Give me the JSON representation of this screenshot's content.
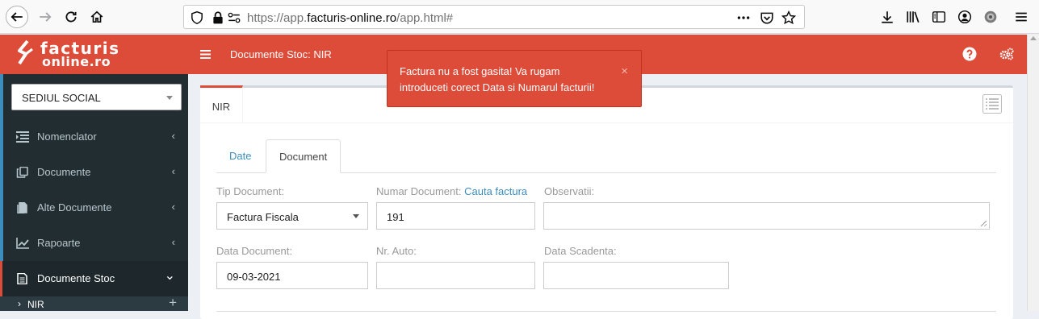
{
  "browser": {
    "url_prefix": "https://app.",
    "url_domain": "facturis-online.ro",
    "url_suffix": "/app.html#"
  },
  "logo": {
    "line1": "facturis",
    "line2": "online.ro"
  },
  "topbar": {
    "title": "Documente Stoc: NIR"
  },
  "company_select": {
    "value": "SEDIUL SOCIAL"
  },
  "sidebar": {
    "items": [
      {
        "label": "Nomenclator",
        "arrow": "‹"
      },
      {
        "label": "Documente",
        "arrow": "‹"
      },
      {
        "label": "Alte Documente",
        "arrow": "‹"
      },
      {
        "label": "Rapoarte",
        "arrow": "‹"
      },
      {
        "label": "Documente Stoc",
        "arrow": "⌄"
      }
    ],
    "sub_item": {
      "label": "NIR",
      "prefix": "›",
      "plus": "+"
    }
  },
  "panel": {
    "tab_label": "NIR"
  },
  "tabs": {
    "date": "Date",
    "document": "Document"
  },
  "form": {
    "tip_document_label": "Tip Document:",
    "tip_document_value": "Factura Fiscala",
    "numar_document_label": "Numar Document:",
    "cauta_factura_link": "Cauta factura",
    "numar_document_value": "191",
    "observatii_label": "Observatii:",
    "observatii_value": "",
    "data_document_label": "Data Document:",
    "data_document_value": "09-03-2021",
    "nr_auto_label": "Nr. Auto:",
    "nr_auto_value": "",
    "data_scadenta_label": "Data Scadenta:",
    "data_scadenta_value": ""
  },
  "toast": {
    "message": "Factura nu a fost gasita! Va rugam introduceti corect Data si Numarul facturii!",
    "close": "×"
  },
  "colors": {
    "brand": "#dd4b39",
    "sidebar": "#222d32",
    "link": "#3c8dbc"
  }
}
